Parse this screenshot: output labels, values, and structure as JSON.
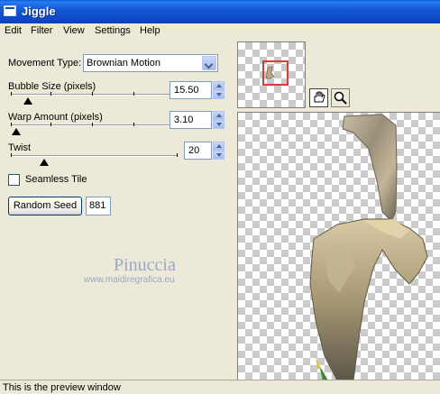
{
  "window": {
    "title": "Jiggle",
    "icon": "window-icon"
  },
  "menu": [
    "Edit",
    "Filter",
    "View",
    "Settings",
    "Help"
  ],
  "controls": {
    "movement_type": {
      "label": "Movement Type:",
      "value": "Brownian Motion"
    },
    "bubble_size": {
      "label": "Bubble Size (pixels)",
      "value": "15.50",
      "slider_fraction": 0.1
    },
    "warp_amount": {
      "label": "Warp Amount (pixels)",
      "value": "3.10",
      "slider_fraction": 0.03
    },
    "twist": {
      "label": "Twist",
      "value": "20",
      "slider_fraction": 0.2
    },
    "seamless_tile": {
      "label": "Seamless Tile",
      "checked": false
    },
    "random_seed": {
      "label": "Random Seed",
      "value": "881"
    }
  },
  "watermark": {
    "name": "Pinuccia",
    "url": "www.maidiregrafica.eu"
  },
  "tools": {
    "pan": "hand-icon",
    "zoom": "magnifier-icon"
  },
  "status": {
    "text": "This is the preview window"
  },
  "colors": {
    "title_bar": "#0a47c4",
    "nav_frame": "#e0393a",
    "face": "#ece9d8"
  }
}
